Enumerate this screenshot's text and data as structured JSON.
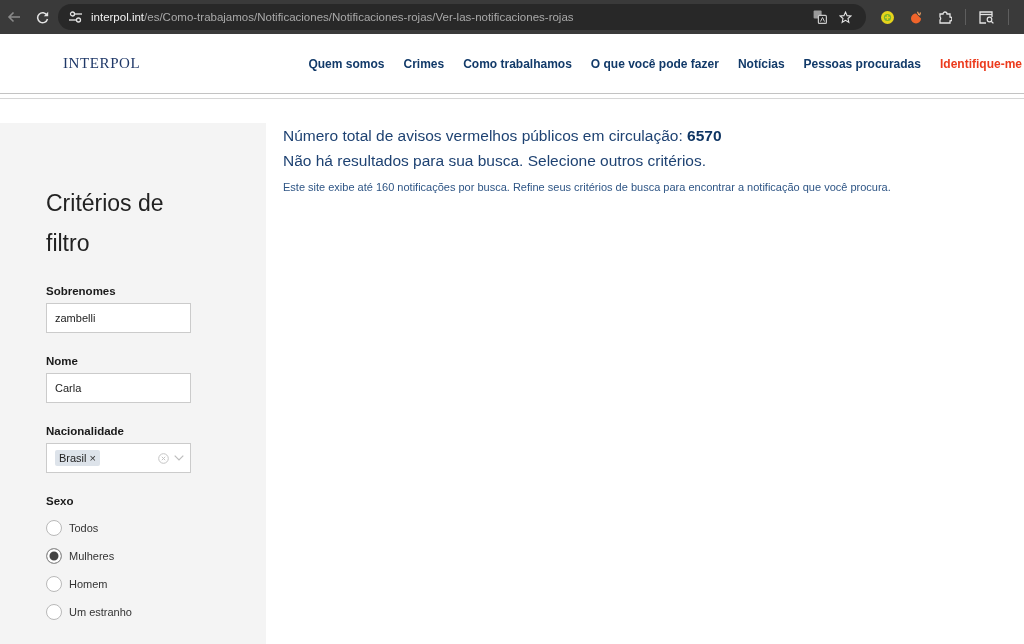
{
  "browser": {
    "back_disabled": true,
    "url_host": "interpol.int",
    "url_path": "/es/Como-trabajamos/Notificaciones/Notificaciones-rojas/Ver-las-notificaciones-rojas"
  },
  "header": {
    "logo": "INTERPOL",
    "nav": [
      {
        "label": "Quem somos",
        "kind": "link"
      },
      {
        "label": "Crimes",
        "kind": "link"
      },
      {
        "label": "Como trabalhamos",
        "kind": "link"
      },
      {
        "label": "O que você pode fazer",
        "kind": "link"
      },
      {
        "label": "Notícias",
        "kind": "link"
      },
      {
        "label": "Pessoas procuradas",
        "kind": "link"
      },
      {
        "label": "Identifique-me",
        "kind": "highlight"
      }
    ]
  },
  "filters": {
    "title": "Critérios de filtro",
    "fields": [
      {
        "kind": "text",
        "label": "Sobrenomes",
        "value": "zambelli"
      },
      {
        "kind": "text",
        "label": "Nome",
        "value": "Carla"
      },
      {
        "kind": "select",
        "label": "Nacionalidade",
        "tags": [
          {
            "label": "Brasil",
            "remove": "×"
          }
        ]
      },
      {
        "kind": "radio",
        "label": "Sexo",
        "options": [
          {
            "label": "Todos",
            "selected": false
          },
          {
            "label": "Mulheres",
            "selected": true
          },
          {
            "label": "Homem",
            "selected": false
          },
          {
            "label": "Um estranho",
            "selected": false
          }
        ]
      }
    ]
  },
  "results": {
    "total": "Número total de avisos vermelhos públicos em circulação: **6570**",
    "message": "Não há resultados para sua busca. Selecione outros critérios.",
    "note": "Este site exibe até 160 notificações por busca. Refine seus critérios de busca para encontrar a notificação que você procura."
  }
}
